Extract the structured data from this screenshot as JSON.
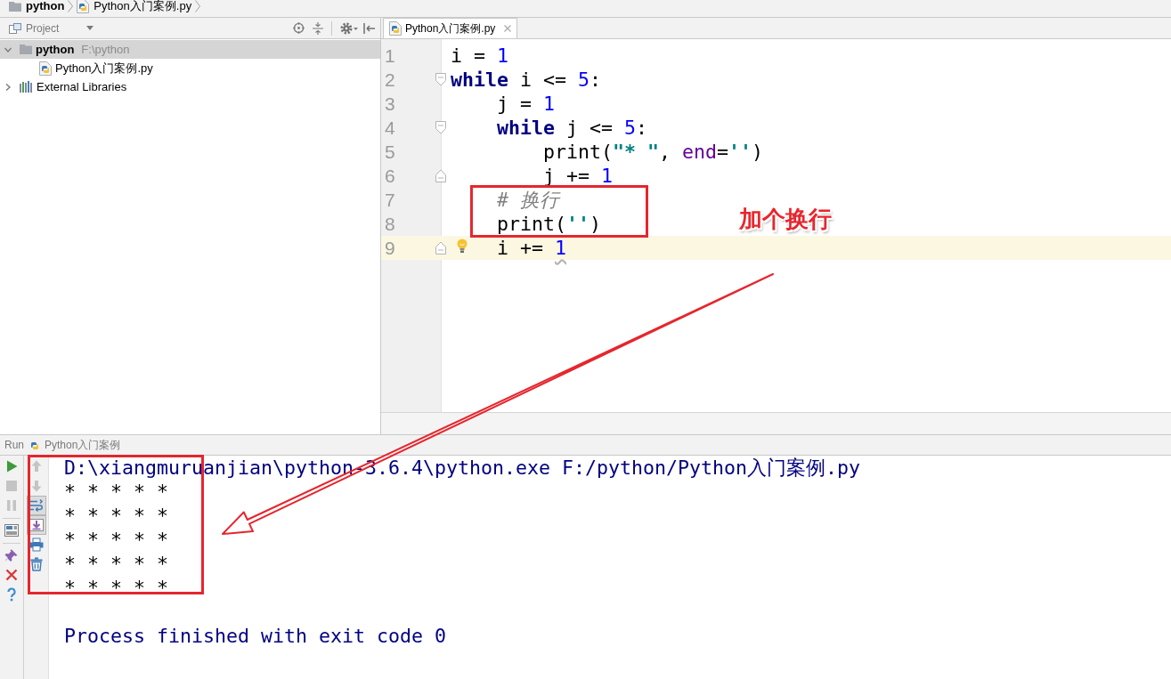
{
  "breadcrumb": [
    {
      "kind": "folder",
      "label": "python"
    },
    {
      "kind": "file",
      "label": "Python入门案例.py"
    }
  ],
  "project_panel": {
    "title": "Project",
    "tree": [
      {
        "kind": "folder",
        "label": "python",
        "path": "F:\\python",
        "expanded": true,
        "selected": true,
        "children": [
          {
            "kind": "file",
            "label": "Python入门案例.py",
            "selected": false
          }
        ]
      },
      {
        "kind": "library",
        "label": "External Libraries",
        "expanded": false,
        "selected": false
      }
    ]
  },
  "editor": {
    "tabs": [
      {
        "label": "Python入门案例.py",
        "selected": true
      }
    ],
    "lines": [
      {
        "number": "1",
        "current": false,
        "fold_start": false,
        "fold_end": false,
        "tokens": [
          {
            "kind": "plain",
            "text": "i = "
          },
          {
            "kind": "number",
            "text": "1"
          }
        ]
      },
      {
        "number": "2",
        "current": false,
        "fold_start": true,
        "fold_end": false,
        "tokens": [
          {
            "kind": "keyword",
            "text": "while"
          },
          {
            "kind": "plain",
            "text": " i <= "
          },
          {
            "kind": "number",
            "text": "5"
          },
          {
            "kind": "plain",
            "text": ":"
          }
        ]
      },
      {
        "number": "3",
        "current": false,
        "fold_start": false,
        "fold_end": false,
        "tokens": [
          {
            "kind": "plain",
            "text": "    j = "
          },
          {
            "kind": "number",
            "text": "1"
          }
        ]
      },
      {
        "number": "4",
        "current": false,
        "fold_start": true,
        "fold_end": false,
        "tokens": [
          {
            "kind": "keyword",
            "text": "    while"
          },
          {
            "kind": "plain",
            "text": " j <= "
          },
          {
            "kind": "number",
            "text": "5"
          },
          {
            "kind": "plain",
            "text": ":"
          }
        ]
      },
      {
        "number": "5",
        "current": false,
        "fold_start": false,
        "fold_end": false,
        "tokens": [
          {
            "kind": "plain",
            "text": "        print("
          },
          {
            "kind": "string",
            "text": "\"* \""
          },
          {
            "kind": "plain",
            "text": ", "
          },
          {
            "kind": "argument",
            "text": "end"
          },
          {
            "kind": "plain",
            "text": "="
          },
          {
            "kind": "string",
            "text": "''"
          },
          {
            "kind": "plain",
            "text": ")"
          }
        ]
      },
      {
        "number": "6",
        "current": false,
        "fold_start": false,
        "fold_end": true,
        "tokens": [
          {
            "kind": "plain",
            "text": "        j += "
          },
          {
            "kind": "number",
            "text": "1"
          }
        ]
      },
      {
        "number": "7",
        "current": false,
        "fold_start": false,
        "fold_end": false,
        "tokens": [
          {
            "kind": "comment",
            "text": "    # 换行"
          }
        ]
      },
      {
        "number": "8",
        "current": false,
        "fold_start": false,
        "fold_end": false,
        "tokens": [
          {
            "kind": "plain",
            "text": "    print("
          },
          {
            "kind": "string",
            "text": "''"
          },
          {
            "kind": "plain",
            "text": ")"
          }
        ]
      },
      {
        "number": "9",
        "current": true,
        "fold_start": false,
        "fold_end": true,
        "bulb": true,
        "tokens": [
          {
            "kind": "plain",
            "text": "    i += "
          },
          {
            "kind": "number",
            "text": "1",
            "warning": true
          }
        ]
      }
    ]
  },
  "run_panel": {
    "title": "Run",
    "config": "Python入门案例",
    "left_toolbar": [
      [
        {
          "kind": "run",
          "disabled": false
        },
        {
          "kind": "stop",
          "disabled": true
        },
        {
          "kind": "pause",
          "disabled": true
        }
      ],
      [
        {
          "kind": "layout",
          "disabled": false
        }
      ],
      [
        {
          "kind": "pin",
          "disabled": false
        },
        {
          "kind": "close",
          "disabled": false
        },
        {
          "kind": "help",
          "disabled": false
        }
      ]
    ],
    "right_toolbar": [
      {
        "kind": "up",
        "disabled": true,
        "toggled": false
      },
      {
        "kind": "down",
        "disabled": true,
        "toggled": false
      },
      {
        "kind": "wrap",
        "disabled": false,
        "toggled": true
      },
      {
        "kind": "scroll_end",
        "disabled": false,
        "toggled": true
      },
      {
        "kind": "print",
        "disabled": false,
        "toggled": false
      },
      {
        "kind": "clear",
        "disabled": false,
        "toggled": false
      }
    ],
    "console": {
      "command": "D:\\xiangmuruanjian\\python-3.6.4\\python.exe F:/python/Python入门案例.py",
      "output": [
        "* * * * *",
        "* * * * *",
        "* * * * *",
        "* * * * *",
        "* * * * *"
      ],
      "exit_message": "Process finished with exit code 0"
    }
  },
  "annotation": {
    "label": "加个换行"
  }
}
